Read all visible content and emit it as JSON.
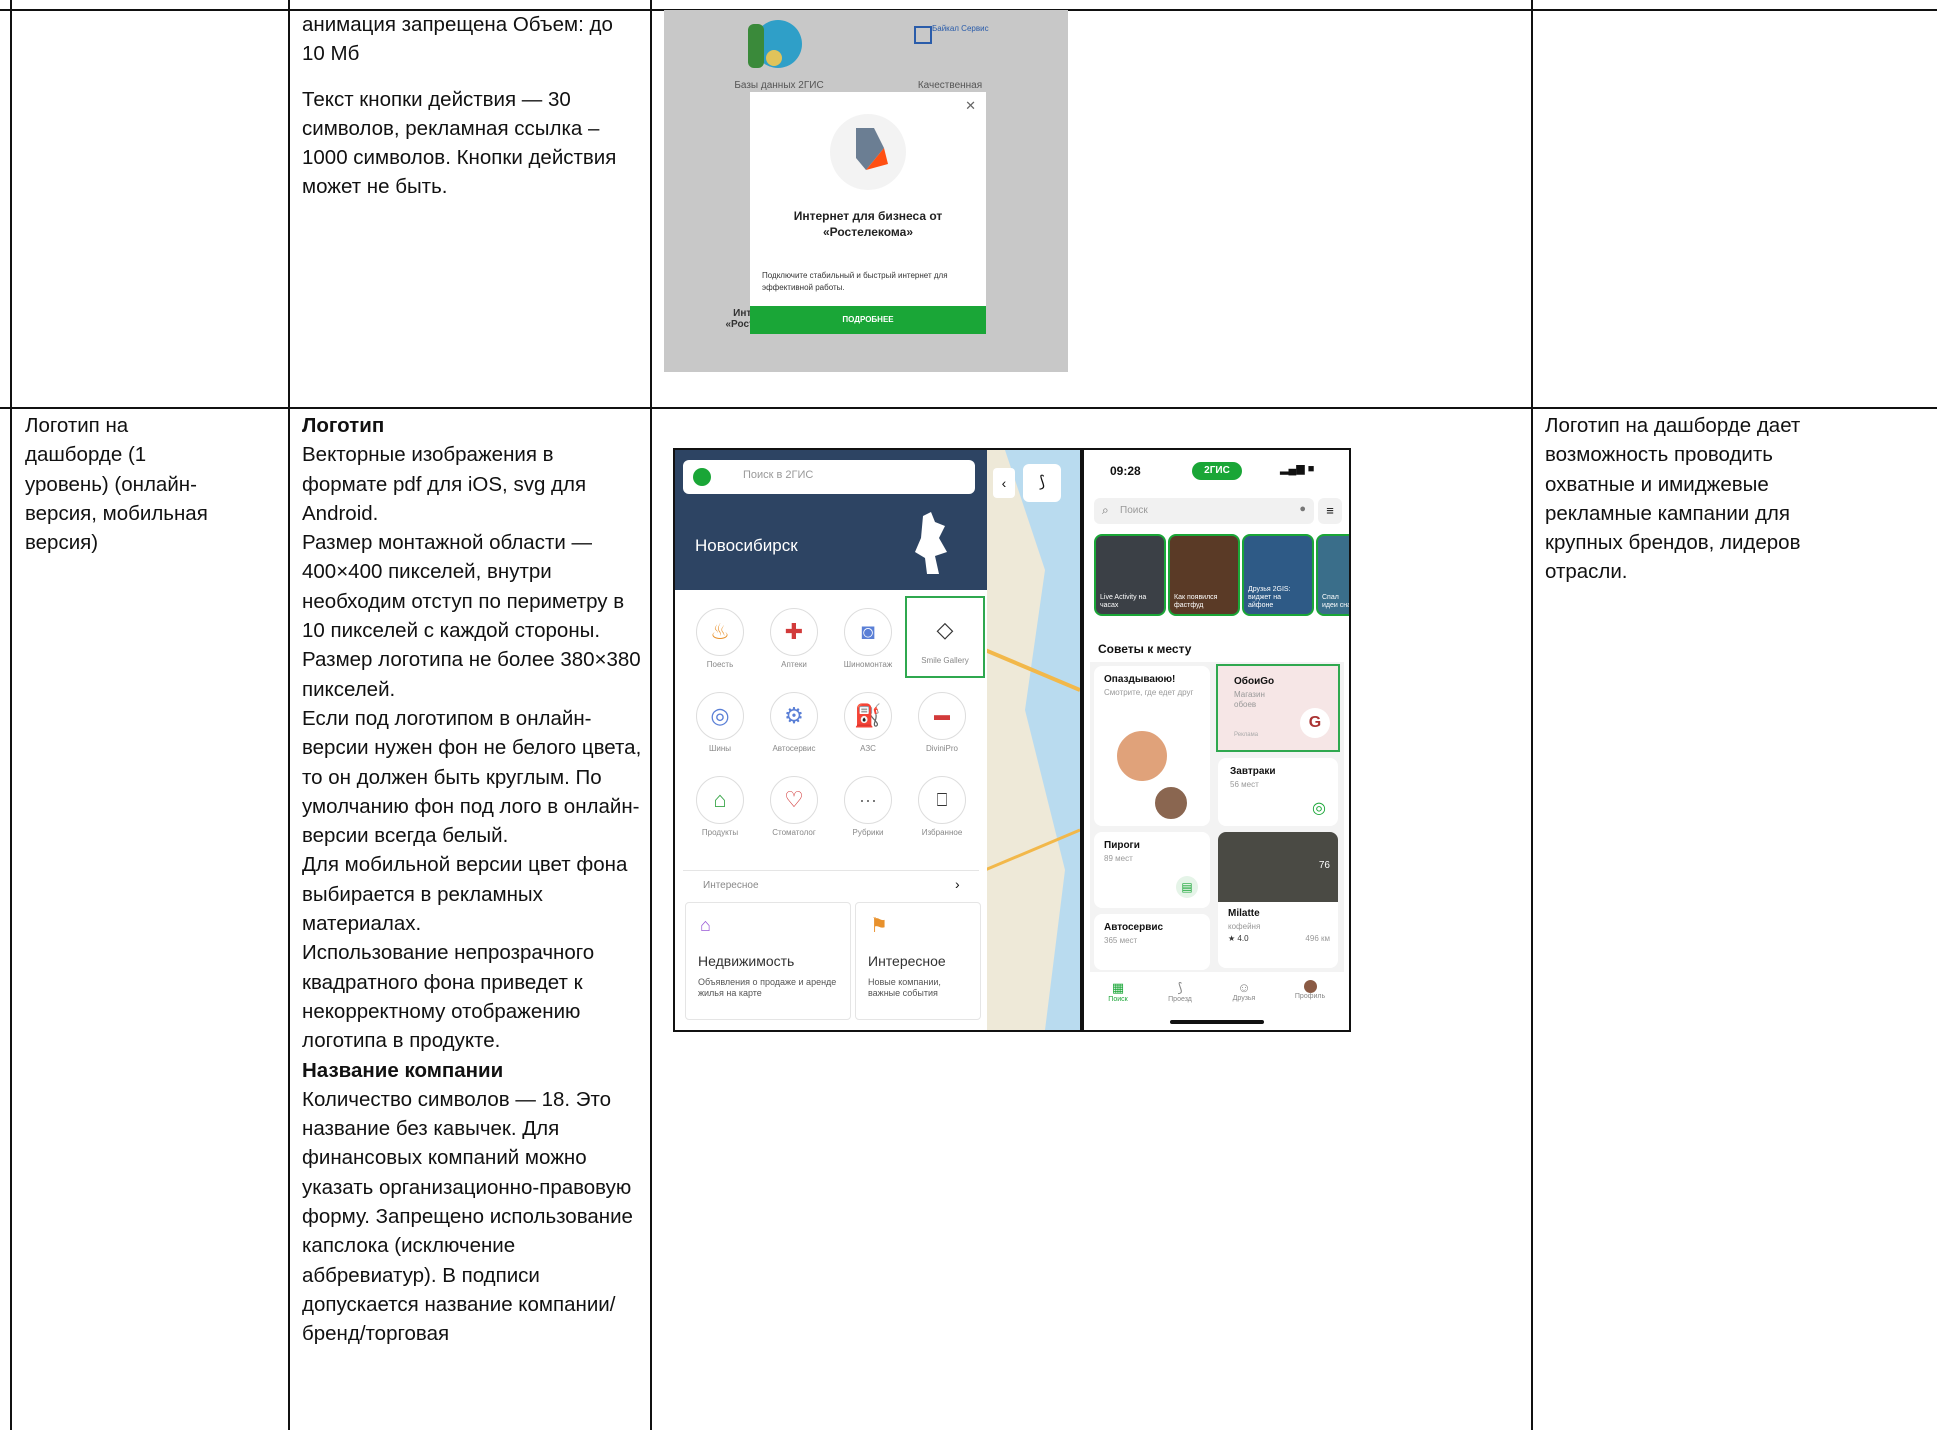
{
  "row1": {
    "col2": {
      "p1": "анимация запрещена Объем: до 10 Мб",
      "p2": "Текст кнопки действия — 30 символов, рекламная ссылка – 1000 символов. Кнопки действия может не быть."
    },
    "image": {
      "bg_item_1": "Базы данных 2ГИС",
      "bg_item_2": "Качественная",
      "brand": "Байкал Сервис",
      "modal_title": "Интернет для бизнеса от «Ростелекома»",
      "modal_desc": "Подключите стабильный и быстрый интернет для эффективной работы.",
      "cta": "ПОДРОБНЕЕ",
      "bg_bottom": "Интернет от «Ростелекома»"
    }
  },
  "row2": {
    "col1": "Логотип на дашборде (1 уровень) (онлайн-версия, мобильная версия)",
    "col2": {
      "logo_heading": "Логотип",
      "logo_body": [
        "Векторные изображения в формате pdf для iOS, svg для Android.",
        "Размер монтажной области — 400×400 пикселей, внутри необходим отступ по периметру в 10 пикселей с каждой стороны.",
        "Размер логотипа не более 380×380 пикселей.",
        "Если под логотипом в онлайн-версии нужен фон не белого цвета, то он должен быть круглым. По умолчанию фон под лого в онлайн-версии всегда белый.",
        "Для мобильной версии цвет фона выбирается в рекламных материалах.",
        "Использование непрозрачного квадратного фона приведет к некорректному отображению логотипа в продукте."
      ],
      "name_heading": "Название компании",
      "name_body": "Количество символов — 18. Это название без кавычек. Для финансовых компаний можно указать организационно-правовую форму. Запрещено использование капслока (исключение аббревиатур). В подписи допускается название компании/бренд/торговая"
    },
    "col4": "Логотип на дашборде дает возможность проводить охватные и имиджевые рекламные кампании для крупных брендов, лидеров отрасли.",
    "phone1": {
      "search_placeholder": "Поиск в 2ГИС",
      "city": "Новосибирск",
      "categories": [
        "Поесть",
        "Аптеки",
        "Шиномонтаж",
        "Smile Gallery",
        "Шины",
        "Автосервис",
        "АЗС",
        "DiviniPro",
        "Продукты",
        "Стоматолог",
        "Рубрики",
        "Избранное"
      ],
      "interesting_label": "Интересное",
      "card1_title": "Недвижимость",
      "card1_desc": "Объявления о продаже и аренде жилья на карте",
      "card2_title": "Интересное",
      "card2_desc": "Новые компании, важные события"
    },
    "phone2": {
      "time": "09:28",
      "badge": "2ГИС",
      "search_placeholder": "Поиск",
      "stories": [
        "Live Activity на часах",
        "Как появился фастфуд",
        "Друзья 2GIS: виджет на айфоне",
        "Спал идеи сна"
      ],
      "section_title": "Советы к месту",
      "tile1_title": "Опаздываюю!",
      "tile1_sub": "Смотрите, где едет друг",
      "tile2_title": "ОбоиGo",
      "tile2_sub": "Магазин обоев",
      "tile2_ad": "Реклама",
      "tile2_logo": "G",
      "tile3_title": "Завтраки",
      "tile3_sub": "56 мест",
      "tile4_title": "Пироги",
      "tile4_sub": "89 мест",
      "tile5_title": "Milatte",
      "tile5_sub": "кофейня",
      "tile5_rating": "★ 4.0",
      "tile5_dist": "496 км",
      "tile5_badge": "76",
      "tile6_title": "Автосервис",
      "tile6_sub": "365 мест",
      "tabs": [
        "Поиск",
        "Проезд",
        "Друзья",
        "Профиль"
      ]
    }
  },
  "colors": {
    "border": "#111111",
    "green": "#1aa637",
    "highlight": "#2fa84f"
  }
}
